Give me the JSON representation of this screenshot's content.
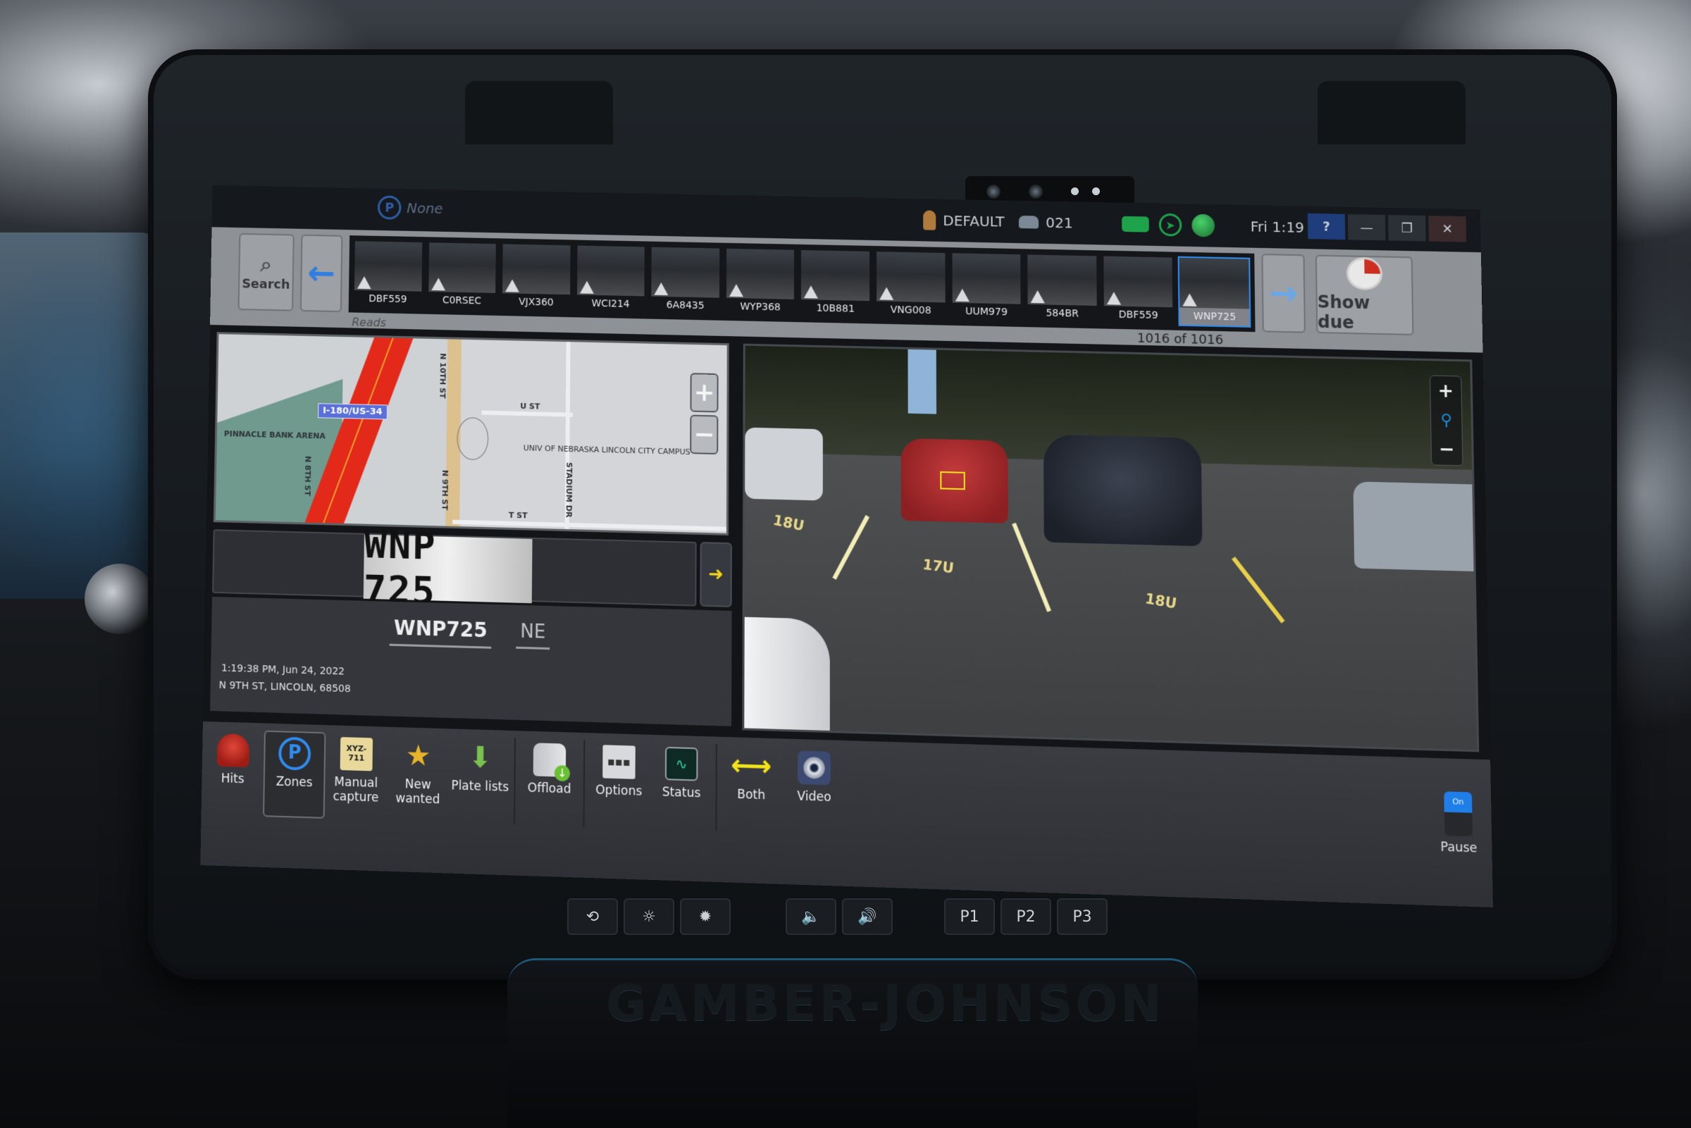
{
  "window": {
    "zone_status": "None",
    "zone_badge": "P",
    "user": "DEFAULT",
    "unit": "021",
    "clock": "Fri 1:19 PM",
    "buttons": {
      "help": "?",
      "minimize": "—",
      "restore": "❐",
      "close": "✕"
    },
    "status_icons": [
      "camera-status-icon",
      "gps-icon",
      "network-icon"
    ]
  },
  "reads": {
    "search_label": "Search",
    "section_label": "Reads",
    "count_text": "1016 of 1016",
    "show_due_label": "Show due",
    "prev_icon": "←",
    "next_icon": "→",
    "thumbnails": [
      {
        "plate": "DBF559",
        "selected": false
      },
      {
        "plate": "C0RSEC",
        "selected": false
      },
      {
        "plate": "VJX360",
        "selected": false
      },
      {
        "plate": "WCI214",
        "selected": false
      },
      {
        "plate": "6A8435",
        "selected": false
      },
      {
        "plate": "WYP368",
        "selected": false
      },
      {
        "plate": "10B881",
        "selected": false
      },
      {
        "plate": "VNG008",
        "selected": false
      },
      {
        "plate": "UUM979",
        "selected": false
      },
      {
        "plate": "584BR",
        "selected": false
      },
      {
        "plate": "DBF559",
        "selected": false
      },
      {
        "plate": "WNP725",
        "selected": true
      }
    ]
  },
  "map": {
    "highway_shield": "I-180/US-34",
    "labels": {
      "arena": "PINNACLE BANK ARENA",
      "n8th": "N 8TH ST",
      "n9th": "N 9TH ST",
      "n10th": "N 10TH ST",
      "u_st": "U ST",
      "t_st": "T ST",
      "stadium": "STADIUM DR",
      "campus": "UNIV OF NEBRASKA LINCOLN CITY CAMPUS"
    },
    "zoom_in": "+",
    "zoom_out": "−"
  },
  "read": {
    "plate_crop_text": "WNP 725",
    "plate": "WNP725",
    "state": "NE",
    "timestamp": "1:19:38 PM, Jun 24, 2022",
    "address": "N 9TH ST, LINCOLN, 68508",
    "direction_icon": "➜"
  },
  "camera": {
    "stall_labels": [
      "18U",
      "17U",
      "18U"
    ],
    "zoom_in": "+",
    "zoom_out": "−",
    "zoom_icon": "🔍"
  },
  "toolbar": {
    "tools": [
      {
        "id": "hits",
        "label": "Hits",
        "icon": ""
      },
      {
        "id": "zones",
        "label": "Zones",
        "icon": "P",
        "active": true
      },
      {
        "id": "manual-capture",
        "label": "Manual capture",
        "icon": "XYZ-711"
      },
      {
        "id": "new-wanted",
        "label": "New wanted",
        "icon": "★"
      },
      {
        "id": "plate-lists",
        "label": "Plate lists",
        "icon": "⬇"
      },
      {
        "id": "offload",
        "label": "Offload",
        "icon": ""
      },
      {
        "id": "options",
        "label": "Options",
        "icon": "▪▪▪"
      },
      {
        "id": "status",
        "label": "Status",
        "icon": "∿"
      },
      {
        "id": "both",
        "label": "Both",
        "icon": "⟷"
      },
      {
        "id": "video",
        "label": "Video",
        "icon": ""
      }
    ],
    "pause_label": "Pause",
    "pause_state": "On"
  },
  "hardware": {
    "buttons_a": [
      "⟲",
      "☼",
      "✹"
    ],
    "buttons_b": [
      "🔈",
      "🔊"
    ],
    "buttons_c": [
      "P1",
      "P2",
      "P3"
    ],
    "brand": "GAMBER-JOHNSON"
  }
}
